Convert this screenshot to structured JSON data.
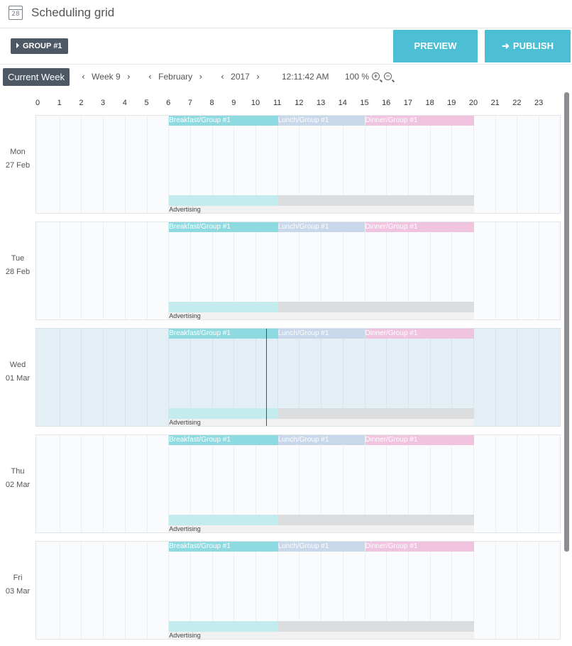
{
  "header": {
    "title": "Scheduling grid",
    "calendar_icon_number": "28"
  },
  "toolbar": {
    "group_label": "GROUP #1",
    "preview_label": "PREVIEW",
    "publish_label": "PUBLISH",
    "current_week_label": "Current Week",
    "week": "Week 9",
    "month": "February",
    "year": "2017",
    "time": "12:11:42 AM",
    "zoom": "100 %"
  },
  "hours": [
    "0",
    "1",
    "2",
    "3",
    "4",
    "5",
    "6",
    "7",
    "8",
    "9",
    "10",
    "11",
    "12",
    "13",
    "14",
    "15",
    "16",
    "17",
    "18",
    "19",
    "20",
    "21",
    "22",
    "23"
  ],
  "days": [
    {
      "weekday": "Mon",
      "date": "27 Feb",
      "today": false
    },
    {
      "weekday": "Tue",
      "date": "28 Feb",
      "today": false
    },
    {
      "weekday": "Wed",
      "date": "01 Mar",
      "today": true
    },
    {
      "weekday": "Thu",
      "date": "02 Mar",
      "today": false
    },
    {
      "weekday": "Fri",
      "date": "03 Mar",
      "today": false
    }
  ],
  "meals": [
    {
      "label": "Breakfast/Group #1",
      "start": 6,
      "end": 11,
      "cls": "bf"
    },
    {
      "label": "Lunch/Group #1",
      "start": 11,
      "end": 15,
      "cls": "ln"
    },
    {
      "label": "Dinner/Group #1",
      "start": 15,
      "end": 20,
      "cls": "dn"
    }
  ],
  "advertising": {
    "label": "Advertising",
    "start": 6,
    "end": 20,
    "filled_until": 11
  },
  "now_hour": 10.45,
  "colors": {
    "accent": "#4dbfd4",
    "dark": "#4d5864",
    "today_bg": "#e4eef5",
    "now_line": "#b5242a"
  }
}
